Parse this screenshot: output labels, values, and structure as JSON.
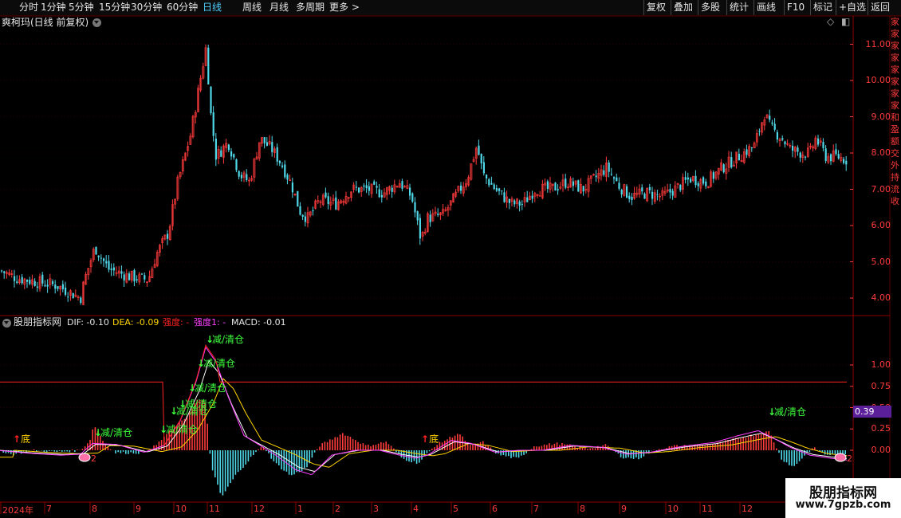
{
  "toolbar": {
    "left_items": [
      "分时",
      "1分钟",
      "5分钟",
      "15分钟",
      "30分钟",
      "60分钟",
      "日线",
      "周线",
      "月线",
      "多周期",
      "更多 >"
    ],
    "active_item": "日线",
    "right_items": [
      "复权",
      "叠加",
      "多股",
      "统计",
      "画线",
      "F10",
      "标记",
      "+自选",
      "返回"
    ]
  },
  "main_panel": {
    "title": "爽柯玛(日线 前复权)",
    "price_axis": [
      "11.00",
      "10.00",
      "9.00",
      "8.00",
      "7.00",
      "6.00",
      "5.00",
      "4.00"
    ]
  },
  "indicator_panel": {
    "name": "股朋指标网",
    "dif": "DIF: -0.10",
    "dea": "DEA: -0.09",
    "strength": "强度: -",
    "strength1": "强度1: -",
    "macd": "MACD: -0.01",
    "axis": [
      "1.00",
      "0.75",
      "0.50",
      "0.25",
      "0.00"
    ],
    "price_box": "0.39",
    "sell_signal_label": "减/清仓",
    "bottom_signal_label": "底",
    "marker_label": "2"
  },
  "date_axis": [
    "2024年",
    "7",
    "8",
    "9",
    "10",
    "11",
    "12",
    "1",
    "2",
    "3",
    "4",
    "5",
    "6",
    "7",
    "8",
    "9",
    "10",
    "11",
    "12"
  ],
  "right_strip_chars": "家家家家家家家家和盈额交外持流收",
  "watermark": {
    "line1": "股朋指标网",
    "line2": "www.7gpzb.com"
  },
  "colors": {
    "up": "#ff3b3b",
    "down": "#4fd8e8",
    "dif": "#ffffff",
    "dea": "#ffd400",
    "strength": "#ff2222",
    "strength1": "#ff40ff",
    "sell_signal": "#3dff3d",
    "active_tab": "#4fd1ff"
  }
}
